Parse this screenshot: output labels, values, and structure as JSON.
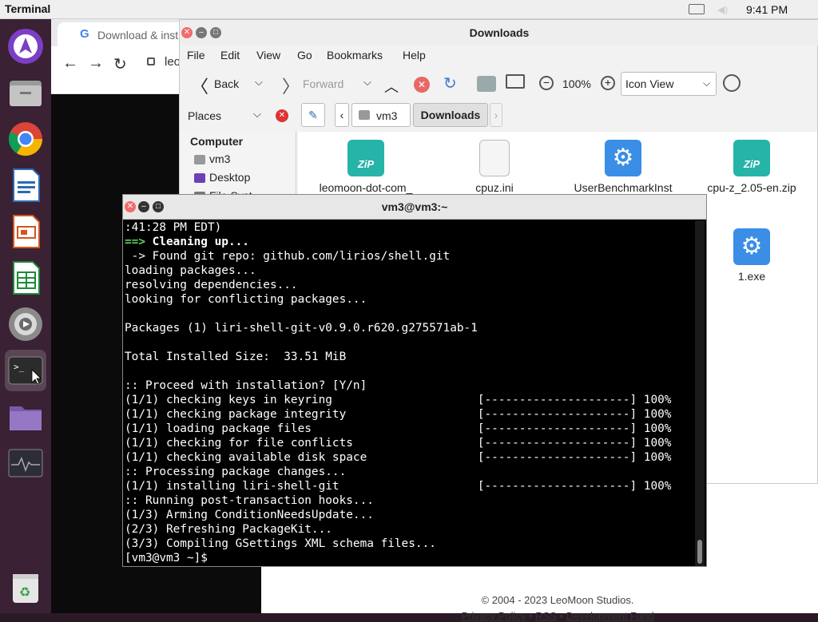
{
  "topbar": {
    "app_name": "Terminal",
    "time": "9:41 PM"
  },
  "dock": {
    "items": [
      "app-launcher-icon",
      "files-icon",
      "chrome-icon",
      "writer-icon",
      "impress-icon",
      "calc-icon",
      "settings-icon",
      "terminal-icon",
      "folder-icon",
      "system-monitor-icon"
    ]
  },
  "browser": {
    "tab_title": "Download & inst",
    "url_partial": "leo",
    "footer_copyright": "© 2004 - 2023 LeoMoon Studios.",
    "footer_privacy": "Privacy Policy",
    "footer_sep1": "•",
    "footer_rss": "RSS",
    "footer_sep2": "•",
    "footer_fund": "Development Fund"
  },
  "file_manager": {
    "title": "Downloads",
    "menu": [
      "File",
      "Edit",
      "View",
      "Go",
      "Bookmarks",
      "Help"
    ],
    "back_label": "Back",
    "forward_label": "Forward",
    "zoom": "100%",
    "view_mode": "Icon View",
    "places_label": "Places",
    "breadcrumb": [
      "vm3",
      "Downloads"
    ],
    "sidebar": {
      "header": "Computer",
      "items": [
        "vm3",
        "Desktop",
        "File Syst"
      ]
    },
    "files": [
      {
        "name": "leomoon-dot-com_",
        "icon": "zip-icon"
      },
      {
        "name": "cpuz.ini",
        "icon": "text-file-icon"
      },
      {
        "name": "UserBenchmarkInst",
        "icon": "exe-gear-icon"
      },
      {
        "name": "cpu-z_2.05-en.zip",
        "icon": "zip-icon"
      },
      {
        "name": "1.exe",
        "icon": "exe-gear-icon"
      }
    ]
  },
  "terminal": {
    "title": "vm3@vm3:~",
    "lines": [
      ":41:28 PM EDT)",
      "==> Cleaning up...",
      " -> Found git repo: github.com/lirios/shell.git",
      "loading packages...",
      "resolving dependencies...",
      "looking for conflicting packages...",
      "",
      "Packages (1) liri-shell-git-v0.9.0.r620.g275571ab-1",
      "",
      "Total Installed Size:  33.51 MiB",
      "",
      ":: Proceed with installation? [Y/n]",
      "(1/1) checking keys in keyring                     [---------------------] 100%",
      "(1/1) checking package integrity                   [---------------------] 100%",
      "(1/1) loading package files                        [---------------------] 100%",
      "(1/1) checking for file conflicts                  [---------------------] 100%",
      "(1/1) checking available disk space                [---------------------] 100%",
      ":: Processing package changes...",
      "(1/1) installing liri-shell-git                    [---------------------] 100%",
      ":: Running post-transaction hooks...",
      "(1/3) Arming ConditionNeedsUpdate...",
      "(2/3) Refreshing PackageKit...",
      "(3/3) Compiling GSettings XML schema files...",
      "[vm3@vm3 ~]$ "
    ]
  }
}
